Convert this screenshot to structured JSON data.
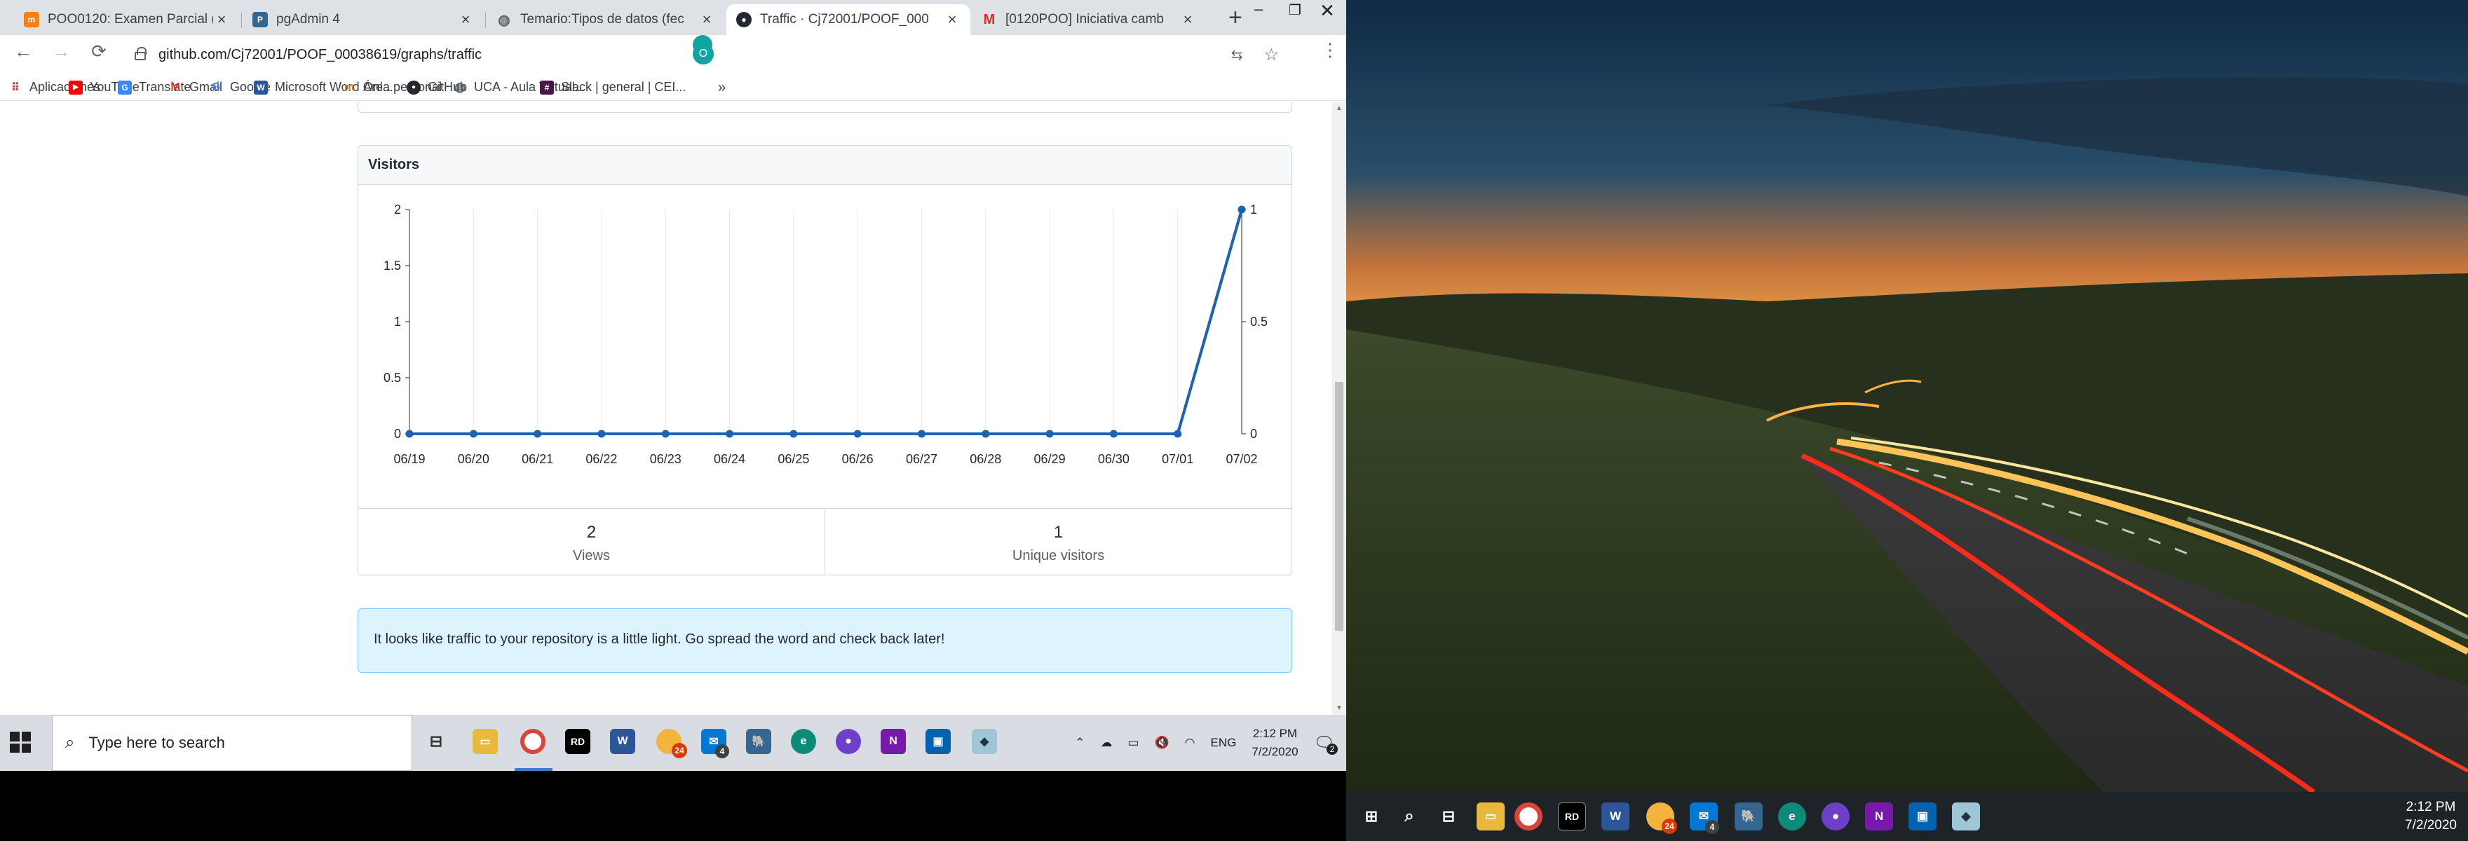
{
  "browser": {
    "tabs": [
      {
        "title": "POO0120: Examen Parcial (",
        "favicon": "moodle-icon",
        "active": false
      },
      {
        "title": "pgAdmin 4",
        "favicon": "pgadmin-icon",
        "active": false
      },
      {
        "title": "Temario:Tipos de datos (fec",
        "favicon": "globe-icon",
        "active": false
      },
      {
        "title": "Traffic · Cj72001/POOF_000",
        "favicon": "github-icon",
        "active": true
      },
      {
        "title": "[0120POO] Iniciativa camb",
        "favicon": "gmail-icon",
        "active": false
      }
    ],
    "address": "github.com/Cj72001/POOF_00038619/graphs/traffic",
    "profile_initial": "O",
    "bookmarks": [
      {
        "label": "Aplicaciones",
        "icon": "apps-grid-icon"
      },
      {
        "label": "YouTube",
        "icon": "youtube-icon"
      },
      {
        "label": "Translate",
        "icon": "translate-icon"
      },
      {
        "label": "Gmail",
        "icon": "gmail-icon"
      },
      {
        "label": "Google",
        "icon": "google-icon"
      },
      {
        "label": "Microsoft Word Onl...",
        "icon": "word-icon"
      },
      {
        "label": "Área personal",
        "icon": "moodle-icon"
      },
      {
        "label": "GitHub",
        "icon": "github-icon"
      },
      {
        "label": "UCA - Aula Virtual...",
        "icon": "globe-icon"
      },
      {
        "label": "Slack | general | CEI...",
        "icon": "slack-icon"
      }
    ],
    "more_bookmarks": "»"
  },
  "traffic": {
    "panel_title": "Visitors",
    "views_count": "2",
    "views_label": "Views",
    "unique_count": "1",
    "unique_label": "Unique visitors",
    "flash_message": "It looks like traffic to your repository is a little light. Go spread the word and check back later!"
  },
  "chart_data": {
    "type": "line",
    "categories": [
      "06/19",
      "06/20",
      "06/21",
      "06/22",
      "06/23",
      "06/24",
      "06/25",
      "06/26",
      "06/27",
      "06/28",
      "06/29",
      "06/30",
      "07/01",
      "07/02"
    ],
    "series": [
      {
        "name": "",
        "axis": "left",
        "color": "#2cbe4e",
        "values": [
          0,
          0,
          0,
          0,
          0,
          0,
          0,
          0,
          0,
          0,
          0,
          0,
          0,
          2
        ]
      },
      {
        "name": "",
        "axis": "right",
        "color": "#1c63b8",
        "values": [
          0,
          0,
          0,
          0,
          0,
          0,
          0,
          0,
          0,
          0,
          0,
          0,
          0,
          1
        ]
      }
    ],
    "y_left": {
      "ticks": [
        "0",
        "0.5",
        "1",
        "1.5",
        "2"
      ],
      "ylim": [
        0,
        2
      ]
    },
    "y_right": {
      "ticks": [
        "0",
        "0.5",
        "1"
      ],
      "ylim": [
        0,
        1
      ]
    },
    "grid": true
  },
  "taskbar_left": {
    "search_placeholder": "Type here to search",
    "time": "2:12 PM",
    "date": "7/2/2020",
    "language": "ENG",
    "notification_count": "2",
    "badges": {
      "mail": "4",
      "chrome_canary": "24"
    }
  },
  "taskbar_right": {
    "time": "2:12 PM",
    "date": "7/2/2020",
    "badges": {
      "mail": "4",
      "chrome_canary": "24"
    }
  }
}
